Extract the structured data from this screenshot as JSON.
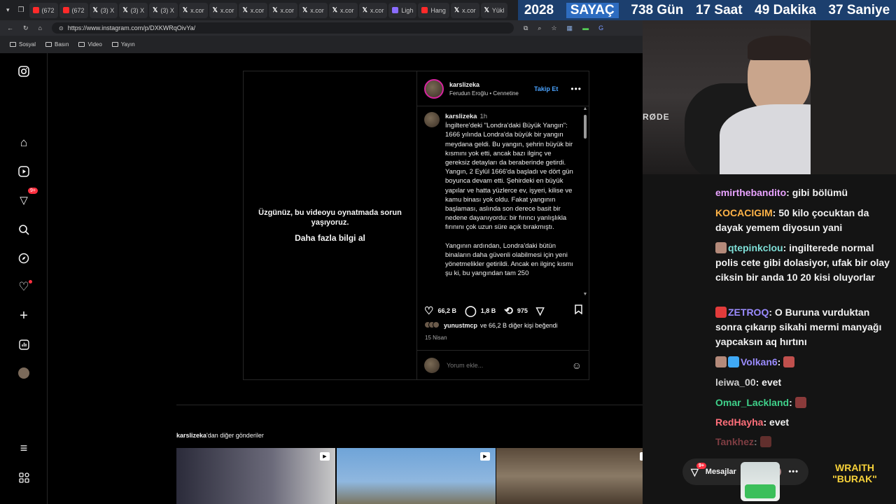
{
  "browser": {
    "tabs": [
      {
        "icon": "yt",
        "label": "(672"
      },
      {
        "icon": "yt",
        "label": "(672"
      },
      {
        "icon": "x",
        "label": "(3) X"
      },
      {
        "icon": "x",
        "label": "(3) X"
      },
      {
        "icon": "x",
        "label": "(3) X"
      },
      {
        "icon": "x",
        "label": "x.cor"
      },
      {
        "icon": "x",
        "label": "x.cor"
      },
      {
        "icon": "x",
        "label": "x.cor"
      },
      {
        "icon": "x",
        "label": "x.cor"
      },
      {
        "icon": "x",
        "label": "x.cor"
      },
      {
        "icon": "x",
        "label": "x.cor"
      },
      {
        "icon": "x",
        "label": "x.cor"
      },
      {
        "icon": "light",
        "label": "Ligh"
      },
      {
        "icon": "yt",
        "label": "Hang"
      },
      {
        "icon": "x",
        "label": "x.cor"
      },
      {
        "icon": "x",
        "label": "Yükl"
      }
    ],
    "url": "https://www.instagram.com/p/DXKWRqOivYa/",
    "bookmarks": [
      "Sosyal",
      "Basın",
      "Video",
      "Yayın"
    ]
  },
  "countdown": {
    "year": "2028",
    "label": "SAYAÇ",
    "days": "738 Gün",
    "hours": "17 Saat",
    "minutes": "49 Dakika",
    "seconds": "37 Saniye"
  },
  "instagram": {
    "nav": {
      "notifications_badge": "9+"
    },
    "video": {
      "error": "Üzgünüz, bu videoyu oynatmada sorun yaşıyoruz.",
      "learn_more": "Daha fazla bilgi al"
    },
    "post": {
      "username": "karslizeka",
      "audio": "Ferudun Eroğlu • Cennetine",
      "follow": "Takip Et",
      "caption_user": "karslizeka",
      "caption_time": "1h",
      "caption_p1": "İngiltere'deki \"Londra'daki Büyük Yangın\": 1666 yılında Londra'da büyük bir yangın meydana geldi. Bu yangın, şehrin büyük bir kısmını yok etti, ancak bazı ilginç ve gereksiz detayları da beraberinde getirdi. Yangın, 2 Eylül 1666'da başladı ve dört gün boyunca devam etti. Şehirdeki en büyük yapılar ve hatta yüzlerce ev, işyeri, kilise ve kamu binası yok oldu. Fakat yangının başlaması, aslında son derece basit bir nedene dayanıyordu: bir fırıncı yanlışlıkla fırınını çok uzun süre açık bırakmıştı.",
      "caption_p2": "Yangının ardından, Londra'daki bütün binaların daha güvenli olabilmesi için yeni yönetmelikler getirildi. Ancak en ilginç kısmı şu ki, bu yangından tam 250",
      "likes": "66,2 B",
      "comments": "1,8 B",
      "reposts": "975",
      "liked_by_user": "yunustmcp",
      "liked_by_rest": "ve 66,2 B diğer kişi beğendi",
      "date": "15 Nisan",
      "comment_placeholder": "Yorum ekle..."
    },
    "more_posts_user": "karslizeka",
    "more_posts_suffix": "'dan diğer gönderiler"
  },
  "stream": {
    "mic_brand": "RØDE",
    "chat": [
      {
        "user": "emirthebandito",
        "color": "#e9a3ff",
        "text": "gibi bölümü"
      },
      {
        "user": "KOCACIGIM",
        "color": "#ffb347",
        "text": "50 kilo çocuktan da dayak yemem diyosun yani"
      },
      {
        "user": "qtepinkclou",
        "color": "#7fe0d8",
        "text": "ingilterede normal polis cete gibi dolasiyor, ufak bir olay ciksin bir anda 10 20 kisi oluyorlar"
      },
      {
        "user": "ZETROQ",
        "color": "#9b8cff",
        "text": "O Buruna vurduktan sonra çıkarıp sikahi mermi manyağı yapcaksın aq hırtını"
      },
      {
        "user": "Volkan6",
        "color": "#9b8cff",
        "text": ""
      },
      {
        "user": "leiwa_00",
        "color": "#cfcfcf",
        "text": "evet"
      },
      {
        "user": "Omar_Lackland",
        "color": "#3fd18a",
        "text": ""
      },
      {
        "user": "RedHayha",
        "color": "#ff6f7a",
        "text": "evet"
      },
      {
        "user": "Tankhez",
        "color": "#ff6f7a",
        "text": ""
      }
    ],
    "dm_label": "Mesajlar",
    "dm_badge": "9+",
    "brand_line1": "WRAITH",
    "brand_line2": "\"BURAK\""
  }
}
